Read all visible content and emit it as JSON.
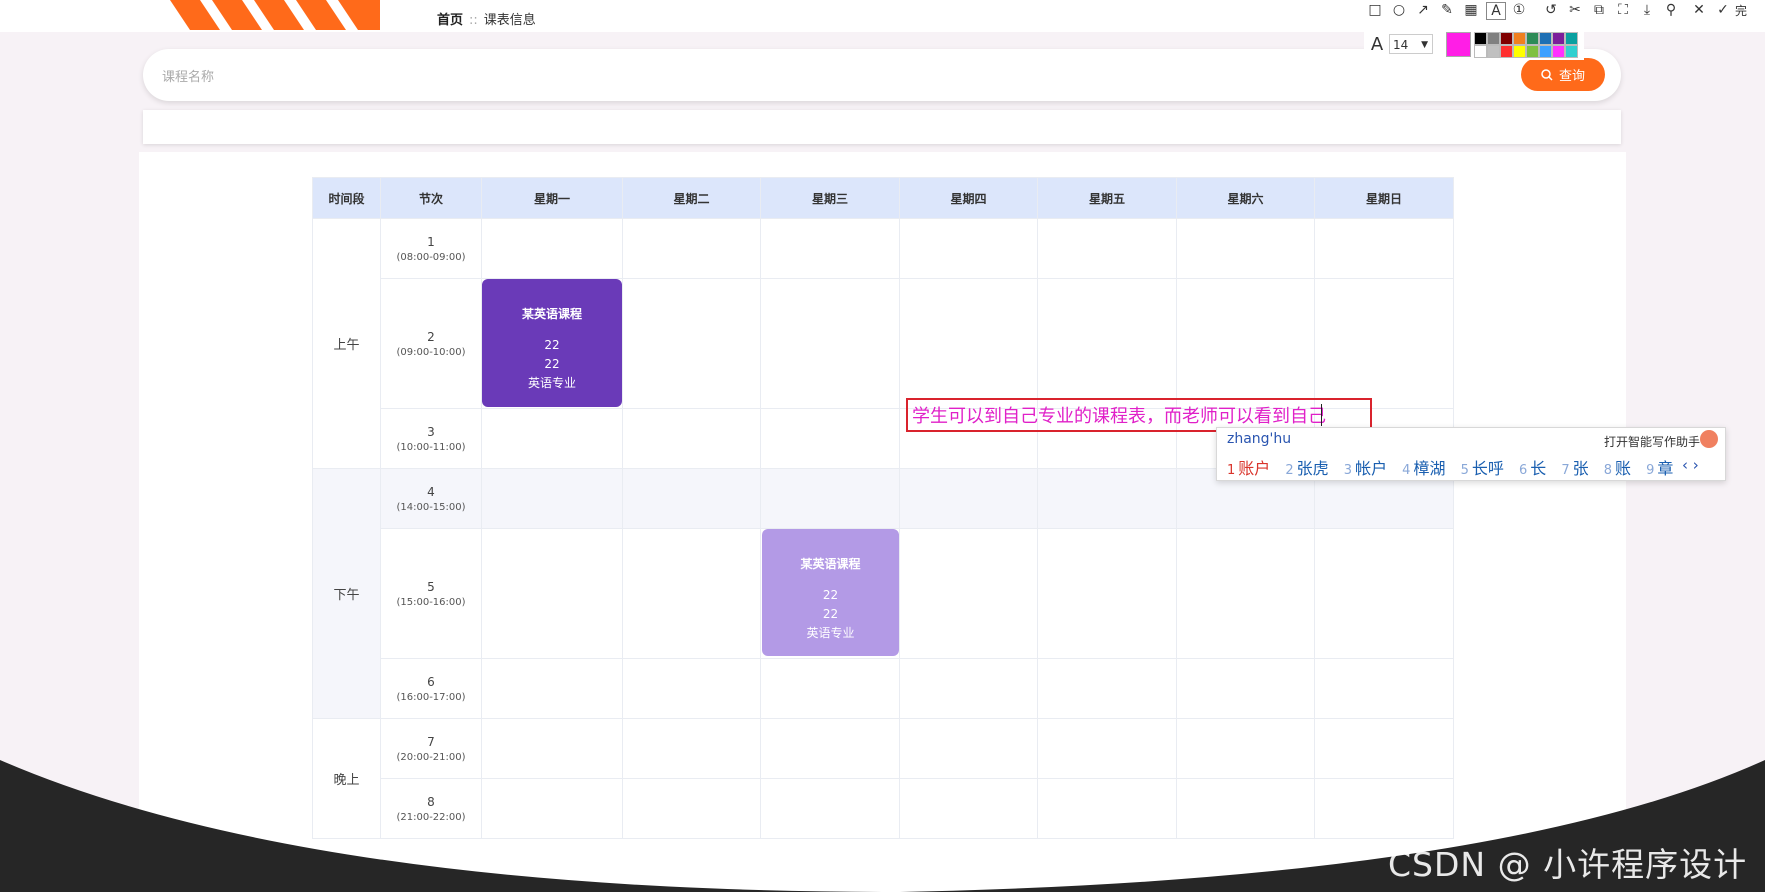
{
  "breadcrumb": {
    "home": "首页",
    "separator": "::",
    "current": "课表信息"
  },
  "search": {
    "placeholder": "课程名称",
    "button_label": "查询"
  },
  "table": {
    "headers": [
      "时间段",
      "节次",
      "星期一",
      "星期二",
      "星期三",
      "星期四",
      "星期五",
      "星期六",
      "星期日"
    ],
    "periods": {
      "morning": "上午",
      "afternoon": "下午",
      "evening": "晚上"
    },
    "sections": [
      {
        "num": "1",
        "time": "(08:00-09:00)"
      },
      {
        "num": "2",
        "time": "(09:00-10:00)"
      },
      {
        "num": "3",
        "time": "(10:00-11:00)"
      },
      {
        "num": "4",
        "time": "(14:00-15:00)"
      },
      {
        "num": "5",
        "time": "(15:00-16:00)"
      },
      {
        "num": "6",
        "time": "(16:00-17:00)"
      },
      {
        "num": "7",
        "time": "(20:00-21:00)"
      },
      {
        "num": "8",
        "time": "(21:00-22:00)"
      }
    ],
    "courses": [
      {
        "name": "某英语课程",
        "line1": "22",
        "line2": "22",
        "major": "英语专业",
        "day": "星期一",
        "section": "2",
        "color": "#6a3ab8"
      },
      {
        "name": "某英语课程",
        "line1": "22",
        "line2": "22",
        "major": "英语专业",
        "day": "星期三",
        "section": "5",
        "color": "#b39ae6"
      }
    ]
  },
  "annotation": {
    "text": "学生可以到自己专业的课程表，而老师可以看到自己",
    "text_color": "#e020c8",
    "border_color": "#d9232d"
  },
  "ime": {
    "pinyin": "zhang'hu",
    "assistant_label": "打开智能写作助手",
    "candidates": [
      {
        "n": "1",
        "text": "账户"
      },
      {
        "n": "2",
        "text": "张虎"
      },
      {
        "n": "3",
        "text": "帐户"
      },
      {
        "n": "4",
        "text": "樟湖"
      },
      {
        "n": "5",
        "text": "长呼"
      },
      {
        "n": "6",
        "text": "长"
      },
      {
        "n": "7",
        "text": "张"
      },
      {
        "n": "8",
        "text": "账"
      },
      {
        "n": "9",
        "text": "章"
      }
    ],
    "pager": "‹ ›"
  },
  "screenshot_tool": {
    "font_size": "14",
    "selected_color": "#ff1ee6",
    "palette": [
      "#000000",
      "#808080",
      "#800000",
      "#f08020",
      "#2e8b57",
      "#1e6fb4",
      "#7b1e9a",
      "#0aa0a0",
      "#ffffff",
      "#c0c0c0",
      "#ff3030",
      "#ffff00",
      "#7fc040",
      "#3ca0ff",
      "#ff30ff",
      "#30d0d0"
    ],
    "icons": [
      "rect-icon",
      "circle-icon",
      "arrow-icon",
      "pen-icon",
      "mosaic-icon",
      "text-icon",
      "number-icon",
      "undo-icon",
      "cut-icon",
      "copy-icon",
      "fullscreen-icon",
      "save-icon",
      "pin-icon",
      "close-icon",
      "done-icon"
    ],
    "done_label": "完"
  },
  "watermark": "CSDN @ 小许程序设计",
  "accent": "#ff6a1a"
}
